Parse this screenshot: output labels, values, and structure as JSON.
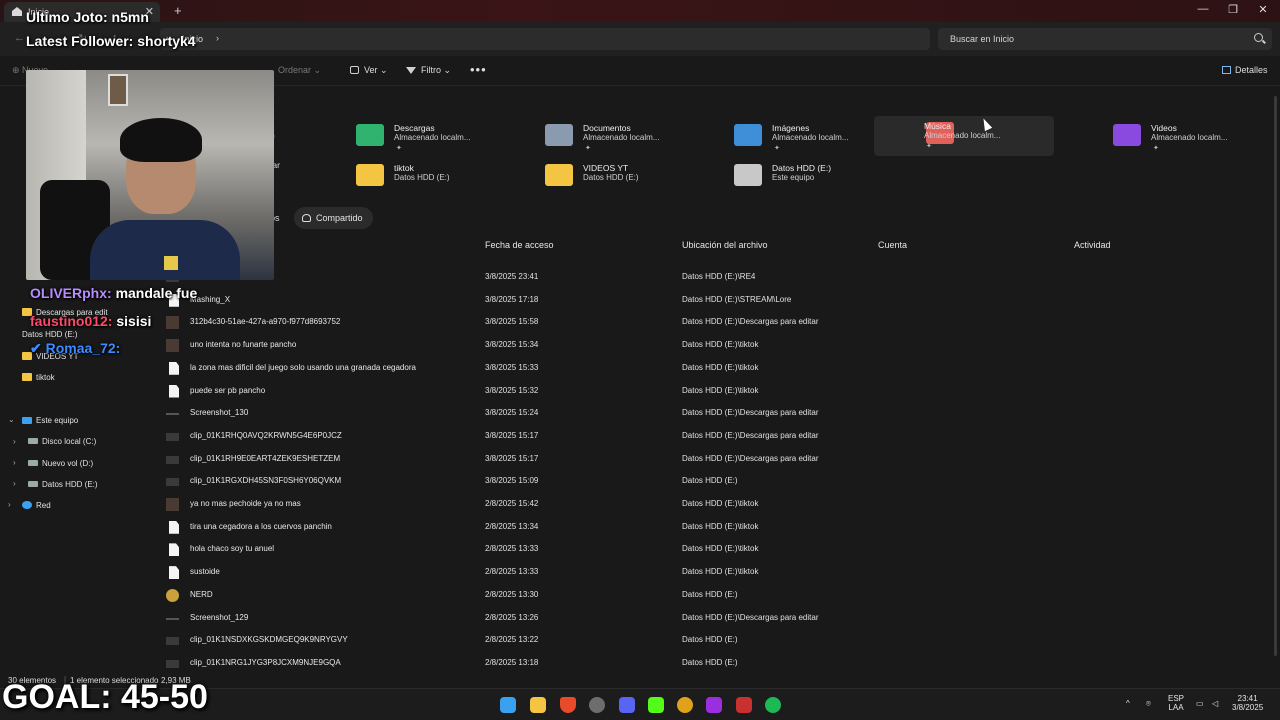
{
  "window": {
    "tab_label": "Inicio",
    "minimize": "—",
    "maximize": "❐",
    "close": "✕"
  },
  "addressbar": {
    "path": "Inicio",
    "search_placeholder": "Buscar en Inicio"
  },
  "toolbar": {
    "new": "Nuevo",
    "sort": "Ordenar",
    "view": "Ver",
    "filter": "Filtro",
    "more": "•••",
    "details": "Detalles"
  },
  "quick_access": [
    {
      "name": "Descargas",
      "sub": "Almacenado localm...",
      "color": "#2fb36f"
    },
    {
      "name": "Documentos",
      "sub": "Almacenado localm...",
      "color": "#8a9bb0"
    },
    {
      "name": "Imágenes",
      "sub": "Almacenado localm...",
      "color": "#3e8fd8"
    },
    {
      "name": "Música",
      "sub": "Almacenado localm...",
      "color": "#e0605a"
    },
    {
      "name": "Videos",
      "sub": "Almacenado localm...",
      "color": "#8a4ae0"
    },
    {
      "name": "tiktok",
      "sub": "Datos HDD (E:)",
      "color": "#f4c443"
    },
    {
      "name": "VIDEOS YT",
      "sub": "Datos HDD (E:)",
      "color": "#f4c443"
    },
    {
      "name": "Datos HDD (E:)",
      "sub": "Este equipo",
      "color": "#c8c8c8"
    }
  ],
  "qa_partial": {
    "a": "n",
    "b": "tar"
  },
  "tabs": {
    "partial": "os",
    "shared": "Compartido"
  },
  "columns": {
    "access_date": "Fecha de acceso",
    "location": "Ubicación del archivo",
    "account": "Cuenta",
    "activity": "Actividad"
  },
  "files": [
    {
      "name": "",
      "date": "3/8/2025 23:41",
      "loc": "Datos HDD (E:)\\RE4",
      "thumb": "t-video"
    },
    {
      "name": "Mashing_X",
      "date": "3/8/2025 17:18",
      "loc": "Datos HDD (E:)\\STREAM\\Lore",
      "thumb": "t-file"
    },
    {
      "name": "312b4c30-51ae-427a-a970-f977d8693752",
      "date": "3/8/2025 15:58",
      "loc": "Datos HDD (E:)\\Descargas para editar",
      "thumb": "t-dark"
    },
    {
      "name": "uno intenta no funarte pancho",
      "date": "3/8/2025 15:34",
      "loc": "Datos HDD (E:)\\tiktok",
      "thumb": "t-dark"
    },
    {
      "name": "la zona mas dificil del juego solo usando una granada cegadora",
      "date": "3/8/2025 15:33",
      "loc": "Datos HDD (E:)\\tiktok",
      "thumb": "t-file"
    },
    {
      "name": "puede ser pb pancho",
      "date": "3/8/2025 15:32",
      "loc": "Datos HDD (E:)\\tiktok",
      "thumb": "t-file"
    },
    {
      "name": "Screenshot_130",
      "date": "3/8/2025 15:24",
      "loc": "Datos HDD (E:)\\Descargas para editar",
      "thumb": "t-line"
    },
    {
      "name": "clip_01K1RHQ0AVQ2KRWN5G4E6P0JCZ",
      "date": "3/8/2025 15:17",
      "loc": "Datos HDD (E:)\\Descargas para editar",
      "thumb": "t-video"
    },
    {
      "name": "clip_01K1RH9E0EART4ZEK9ESHETZEM",
      "date": "3/8/2025 15:17",
      "loc": "Datos HDD (E:)\\Descargas para editar",
      "thumb": "t-video"
    },
    {
      "name": "clip_01K1RGXDH45SN3F0SH6Y06QVKM",
      "date": "3/8/2025 15:09",
      "loc": "Datos HDD (E:)",
      "thumb": "t-video"
    },
    {
      "name": "ya no mas pechoide ya no mas",
      "date": "2/8/2025 15:42",
      "loc": "Datos HDD (E:)\\tiktok",
      "thumb": "t-dark"
    },
    {
      "name": "tira una cegadora a los cuervos panchin",
      "date": "2/8/2025 13:34",
      "loc": "Datos HDD (E:)\\tiktok",
      "thumb": "t-file"
    },
    {
      "name": "hola chaco soy tu anuel",
      "date": "2/8/2025 13:33",
      "loc": "Datos HDD (E:)\\tiktok",
      "thumb": "t-file"
    },
    {
      "name": "sustoide",
      "date": "2/8/2025 13:33",
      "loc": "Datos HDD (E:)\\tiktok",
      "thumb": "t-file"
    },
    {
      "name": "NERD",
      "date": "2/8/2025 13:30",
      "loc": "Datos HDD (E:)",
      "thumb": "t-nerd"
    },
    {
      "name": "Screenshot_129",
      "date": "2/8/2025 13:26",
      "loc": "Datos HDD (E:)\\Descargas para editar",
      "thumb": "t-line"
    },
    {
      "name": "clip_01K1NSDXKGSKDMGEQ9K9NRYGVY",
      "date": "2/8/2025 13:22",
      "loc": "Datos HDD (E:)",
      "thumb": "t-video"
    },
    {
      "name": "clip_01K1NRG1JYG3P8JCXM9NJE9GQA",
      "date": "2/8/2025 13:18",
      "loc": "Datos HDD (E:)",
      "thumb": "t-video"
    }
  ],
  "sidebar": {
    "folders": [
      "Descargas para edit",
      "Datos HDD (E:)",
      "VIDEOS YT",
      "tiktok"
    ],
    "this_pc": "Este equipo",
    "drives": [
      "Disco local (C:)",
      "Nuevo vol (D:)",
      "Datos HDD (E:)"
    ],
    "network": "Red"
  },
  "status": {
    "count": "30 elementos",
    "selected": "1 elemento seleccionado",
    "size": "2,93 MB"
  },
  "taskbar": {
    "lang1": "ESP",
    "lang2": "LAA",
    "time": "23:41",
    "date": "3/8/2025"
  },
  "overlay": {
    "last_sub": "Ultimo Joto: n5mn",
    "last_follower": "Latest Follower: shortyk4",
    "chat": [
      {
        "user": "OLIVERphx:",
        "msg": "mandale fue",
        "color": "#b78cff"
      },
      {
        "user": "faustino012:",
        "msg": "sisisi",
        "color": "#ff4a6a"
      },
      {
        "user": "Romaa_72:",
        "msg": "",
        "color": "#3c8cff"
      }
    ],
    "goal": "GOAL: 45-50"
  }
}
